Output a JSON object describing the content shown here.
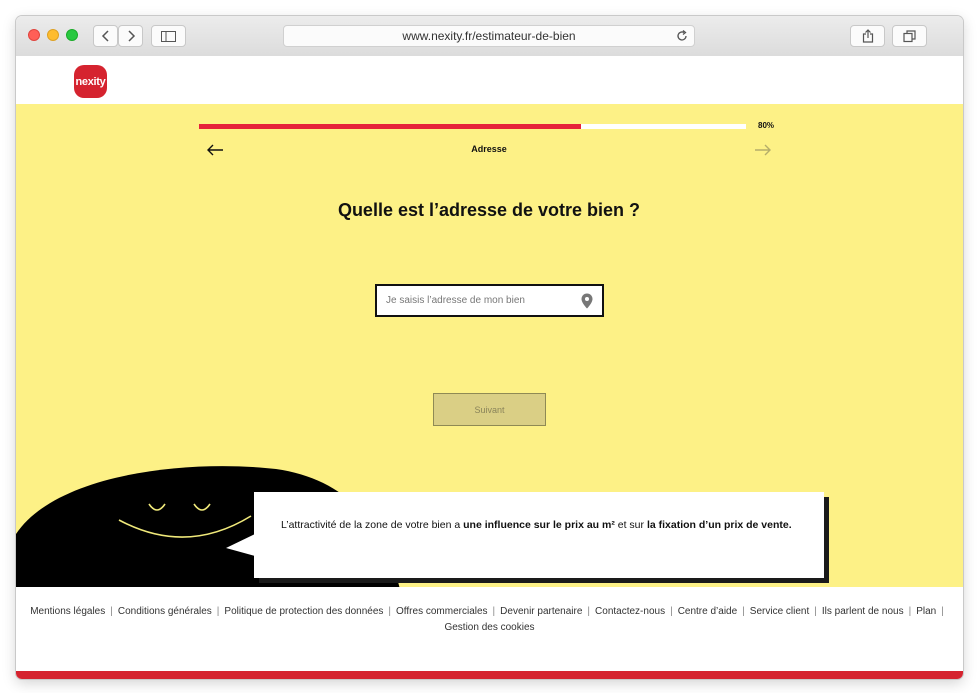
{
  "browser": {
    "url": "www.nexity.fr/estimateur-de-bien",
    "icons": [
      "back-icon",
      "forward-icon",
      "sidebar-icon",
      "reload-icon",
      "share-icon",
      "tabs-icon"
    ]
  },
  "header": {
    "logo_text": "nexity"
  },
  "progress": {
    "value": 0.8,
    "label": "80%"
  },
  "step": {
    "title": "Adresse"
  },
  "question": "Quelle est l’adresse de votre bien ?",
  "address": {
    "placeholder": "Je saisis l’adresse de mon bien",
    "value": ""
  },
  "next_button": {
    "label": "Suivant"
  },
  "tip": {
    "part1": "L’attractivité de la zone de votre bien a ",
    "bold1": "une influence sur le prix au m²",
    "part2": " et sur ",
    "bold2": "la fixation d’un prix de vente."
  },
  "footer": {
    "links": [
      "Mentions légales",
      "Conditions générales",
      "Politique de protection des données",
      "Offres commerciales",
      "Devenir partenaire",
      "Contactez-nous",
      "Centre d’aide",
      "Service client",
      "Ils parlent de nous",
      "Plan",
      "Gestion des cookies"
    ]
  },
  "colors": {
    "brand_red": "#d5232f",
    "progress_red": "#e6223a",
    "stage_yellow": "#fdf186"
  }
}
